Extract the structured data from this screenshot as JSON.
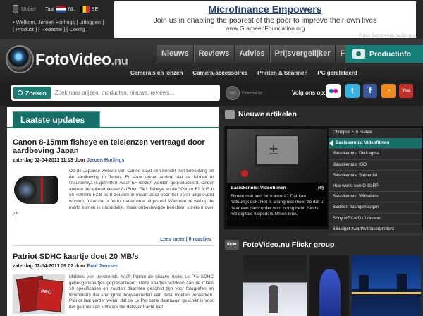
{
  "topbar": {
    "mobile_label": "Mobiel",
    "taal_label": "Taal",
    "langs": [
      "NL",
      "BE"
    ],
    "user_line": "• Welkom, Jeroen Horlings  [ uitloggen ]",
    "links_line": "[ Product ]  [ Redactie ]  [ Config ]"
  },
  "ad": {
    "title": "Microfinance Empowers",
    "text": "Join us in enabling the poorest of the poor to improve their own lives",
    "url": "www.GrameenFoundation.org",
    "label": "Public Service Ads by Google"
  },
  "header": {
    "logo_main": "FotoVideo",
    "logo_suffix": ".nu",
    "nav": [
      "Nieuws",
      "Reviews",
      "Advies",
      "Prijsvergelijker",
      "Forum"
    ],
    "productinfo": "Productinfo",
    "subnav": [
      "Camera's en lenzen",
      "Camera-accessoires",
      "Printen & Scannen",
      "PC gerelateerd"
    ]
  },
  "search": {
    "button": "Zoeken",
    "placeholder": "Zoek naar prijzen, producten, nieuws, reviews...",
    "powered_label": "Powered by",
    "follow_label": "Volg ons op:",
    "social": [
      "flickr",
      "twitter",
      "facebook",
      "rss",
      "YouTube"
    ]
  },
  "updates": {
    "tab": "Laatste updates",
    "articles": [
      {
        "title": "Canon 8-15mm fisheye en telelenzen vertraagd door aardbeving Japan",
        "date": "zaterdag 02-04-2011 11:13 door",
        "author": "Jeroen Horlings",
        "body": "Op de Japanse website van Canon staat een bericht met betrekking tot de aardbeving in Japan. Er staat onder andere dat de fabriek in Utsunomiya is getroffen, waar EF lenzen worden geproduceerd. Onder andere de splinternieuwe 8-15mm F4 L fisheye en de 300mm F2.8 IS II en 400mm F2.8 IS II zouden in maart 2011 voor het eerst uitgeleverd worden, maar dat is nu tot nader orde uitgesteld. Wanneer ze wel op de markt komen is onduidelijk, maar onbestevigde berichten spreken over juli.",
        "more": "Lees meer | 0 reacties"
      },
      {
        "title": "Patriot SDHC kaartje doet 20 MB/s",
        "date": "zaterdag 02-04-2011 09:02 door",
        "author": "Paul Janssen",
        "body": "Middels een persbericht heeft Patriot de nieuwe reeks Lx Pro SDHC geheugenkaartjes gepresenteerd. Deze kaartjes voldoen aan de Class 10 specificaties en zouden daarmee geschikt zijn voor fotografen en filmmakers die snel grote hoeveelheden aan data moeten verwerken. Patriot laat verder weten dat de Lx Pro serie daarnaast geschikt is voor het gebruik van software die dataverdracht met"
      }
    ]
  },
  "right": {
    "nieuwe_title": "Nieuwe artikelen",
    "slide": {
      "caption_title": "Basiskennis: Videofilmen",
      "caption_count": "(0)",
      "caption_text": "Filmen met een fotocamera? Dat kan natuurlijk ook. Het is allang niet meer zo dat u daar een camcorder voor nodig hebt. Sinds het digitale tijdperk is filmen leuk."
    },
    "list": [
      "Olympus E-5 review",
      "Basiskennis: Videofilmen",
      "Basiskennis: Diafragma",
      "Basiskennis: ISO",
      "Basiskennis: Sluitertijd",
      "Hoe werkt een D-SLR?",
      "Basiskennis: Witbalans",
      "Soorten flashgeheugen",
      "Sony NEX-VG10 review",
      "6 budget zwart/wit laserprinters"
    ],
    "active_index": 1,
    "flickr_badge": "flickr",
    "flickr_title": "FotoVideo.nu Flickr group"
  }
}
